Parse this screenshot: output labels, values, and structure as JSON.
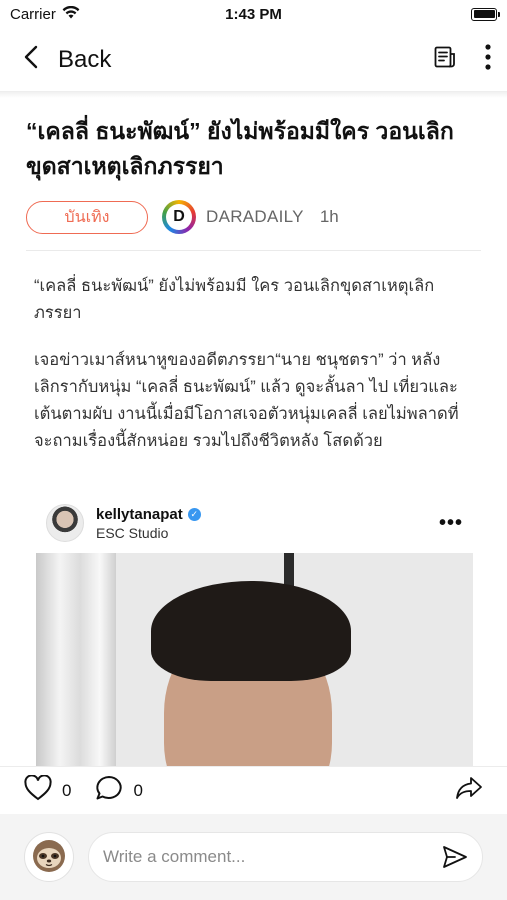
{
  "status_bar": {
    "carrier": "Carrier",
    "time": "1:43 PM",
    "battery_level": 1.0
  },
  "nav": {
    "back_label": "Back",
    "icons": [
      "reader-icon",
      "more-vertical-icon"
    ]
  },
  "article": {
    "title": "“เคลลี่ ธนะพัฒน์” ยังไม่พร้อมมีใคร วอนเลิกขุดสาเหตุเลิกภรรยา",
    "category": "บันเทิง",
    "source_logo_letter": "D",
    "source": "DARADAILY",
    "time_ago": "1h",
    "paragraphs": [
      "“เคลลี่ ธนะพัฒน์” ยังไม่พร้อมมี ใคร วอนเลิกขุดสาเหตุเลิกภรรยา",
      "เจอข่าวเมาส์หนาหูของอดีตภรรยา“นาย ชนุชตรา” ว่า หลังเลิกรากับหนุ่ม “เคลลี่ ธนะพัฒน์” แล้ว ดูจะลั้นลา ไป เที่ยวและเต้นตามผับ งานนี้เมื่อมีโอกาสเจอตัวหนุ่มเคลลี่ เลยไม่พลาดที่จะถามเรื่องนี้สักหน่อย รวมไปถึงชีวิตหลัง โสดด้วย"
    ]
  },
  "embed": {
    "username": "kellytanapat",
    "subtitle": "ESC Studio",
    "more_label": "•••",
    "verified": true
  },
  "actions": {
    "likes": "0",
    "comments": "0"
  },
  "comment": {
    "placeholder": "Write a comment..."
  },
  "colors": {
    "accent": "#ef6b53",
    "verified": "#3897f0"
  }
}
